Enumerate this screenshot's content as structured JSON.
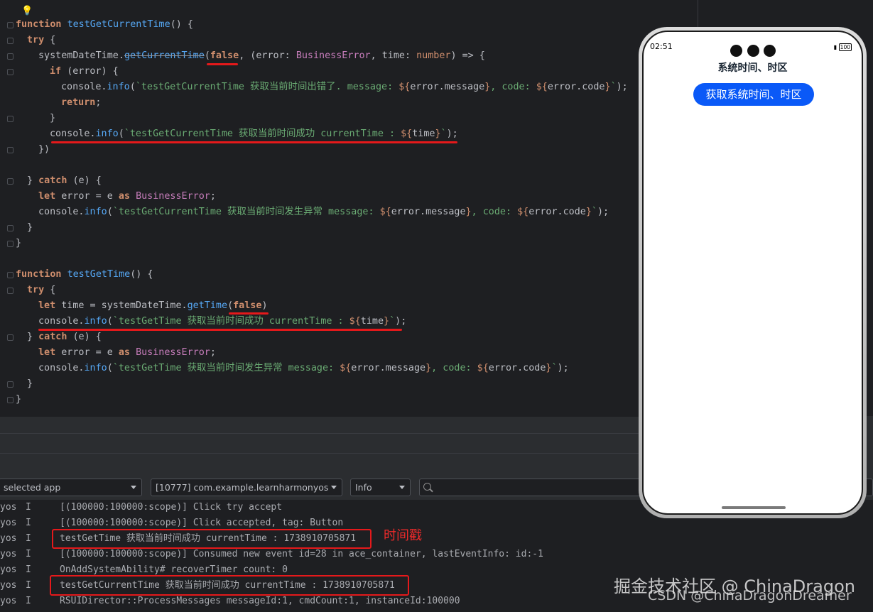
{
  "editor": {
    "lines": [
      {
        "indent": 0,
        "tokens": [
          [
            "kw",
            "function "
          ],
          [
            "fn",
            "testGetCurrentTime"
          ],
          [
            "nm",
            "() {"
          ]
        ]
      },
      {
        "indent": 1,
        "tokens": [
          [
            "kw",
            "try "
          ],
          [
            "nm",
            "{"
          ]
        ]
      },
      {
        "indent": 2,
        "tokens": [
          [
            "nm",
            "systemDateTime."
          ],
          [
            "fn-strike",
            "getCurrentTime"
          ],
          [
            "nm",
            "("
          ],
          [
            "bool",
            "false"
          ],
          [
            "nm",
            ", (error: "
          ],
          [
            "ty",
            "BusinessError"
          ],
          [
            "nm",
            ", time: "
          ],
          [
            "tyo",
            "number"
          ],
          [
            "nm",
            ") => {"
          ]
        ]
      },
      {
        "indent": 3,
        "tokens": [
          [
            "kw",
            "if "
          ],
          [
            "nm",
            "(error) {"
          ]
        ]
      },
      {
        "indent": 4,
        "tokens": [
          [
            "nm",
            "console."
          ],
          [
            "fn",
            "info"
          ],
          [
            "nm",
            "("
          ],
          [
            "str",
            "`testGetCurrentTime 获取当前时间出错了. message: "
          ],
          [
            "tpl",
            "${"
          ],
          [
            "nm",
            "error.message"
          ],
          [
            "tpl",
            "}"
          ],
          [
            "str",
            ", code: "
          ],
          [
            "tpl",
            "${"
          ],
          [
            "nm",
            "error.code"
          ],
          [
            "tpl",
            "}"
          ],
          [
            "str",
            "`"
          ],
          [
            "nm",
            ");"
          ]
        ]
      },
      {
        "indent": 4,
        "tokens": [
          [
            "kw",
            "return"
          ],
          [
            "nm",
            ";"
          ]
        ]
      },
      {
        "indent": 3,
        "tokens": [
          [
            "nm",
            "}"
          ]
        ]
      },
      {
        "indent": 3,
        "tokens": [
          [
            "nm",
            "console."
          ],
          [
            "fn",
            "info"
          ],
          [
            "nm",
            "("
          ],
          [
            "str",
            "`testGetCurrentTime 获取当前时间成功 currentTime : "
          ],
          [
            "tpl",
            "${"
          ],
          [
            "nm",
            "time"
          ],
          [
            "tpl",
            "}"
          ],
          [
            "str",
            "`"
          ],
          [
            "nm",
            ");"
          ]
        ]
      },
      {
        "indent": 2,
        "tokens": [
          [
            "nm",
            "})"
          ]
        ]
      },
      {
        "indent": 0,
        "tokens": []
      },
      {
        "indent": 1,
        "tokens": [
          [
            "nm",
            "} "
          ],
          [
            "kw",
            "catch "
          ],
          [
            "nm",
            "(e) {"
          ]
        ]
      },
      {
        "indent": 2,
        "tokens": [
          [
            "kw",
            "let "
          ],
          [
            "nm",
            "error = e "
          ],
          [
            "kw",
            "as "
          ],
          [
            "ty",
            "BusinessError"
          ],
          [
            "nm",
            ";"
          ]
        ]
      },
      {
        "indent": 2,
        "tokens": [
          [
            "nm",
            "console."
          ],
          [
            "fn",
            "info"
          ],
          [
            "nm",
            "("
          ],
          [
            "str",
            "`testGetCurrentTime 获取当前时间发生异常 message: "
          ],
          [
            "tpl",
            "${"
          ],
          [
            "nm",
            "error.message"
          ],
          [
            "tpl",
            "}"
          ],
          [
            "str",
            ", code: "
          ],
          [
            "tpl",
            "${"
          ],
          [
            "nm",
            "error.code"
          ],
          [
            "tpl",
            "}"
          ],
          [
            "str",
            "`"
          ],
          [
            "nm",
            ");"
          ]
        ]
      },
      {
        "indent": 1,
        "tokens": [
          [
            "nm",
            "}"
          ]
        ]
      },
      {
        "indent": 0,
        "tokens": [
          [
            "nm",
            "}"
          ]
        ]
      },
      {
        "indent": 0,
        "tokens": []
      },
      {
        "indent": 0,
        "tokens": [
          [
            "kw",
            "function "
          ],
          [
            "fn",
            "testGetTime"
          ],
          [
            "nm",
            "() {"
          ]
        ]
      },
      {
        "indent": 1,
        "tokens": [
          [
            "kw",
            "try "
          ],
          [
            "nm",
            "{"
          ]
        ]
      },
      {
        "indent": 2,
        "tokens": [
          [
            "kw",
            "let "
          ],
          [
            "nm",
            "time = systemDateTime."
          ],
          [
            "fn",
            "getTime"
          ],
          [
            "nm",
            "("
          ],
          [
            "bool",
            "false"
          ],
          [
            "nm",
            ")"
          ]
        ]
      },
      {
        "indent": 2,
        "tokens": [
          [
            "nm",
            "console."
          ],
          [
            "fn",
            "info"
          ],
          [
            "nm",
            "("
          ],
          [
            "str",
            "`testGetTime 获取当前时间成功 currentTime : "
          ],
          [
            "tpl",
            "${"
          ],
          [
            "nm",
            "time"
          ],
          [
            "tpl",
            "}"
          ],
          [
            "str",
            "`"
          ],
          [
            "nm",
            ");"
          ]
        ]
      },
      {
        "indent": 1,
        "tokens": [
          [
            "nm",
            "} "
          ],
          [
            "kw",
            "catch "
          ],
          [
            "nm",
            "(e) {"
          ]
        ]
      },
      {
        "indent": 2,
        "tokens": [
          [
            "kw",
            "let "
          ],
          [
            "nm",
            "error = e "
          ],
          [
            "kw",
            "as "
          ],
          [
            "ty",
            "BusinessError"
          ],
          [
            "nm",
            ";"
          ]
        ]
      },
      {
        "indent": 2,
        "tokens": [
          [
            "nm",
            "console."
          ],
          [
            "fn",
            "info"
          ],
          [
            "nm",
            "("
          ],
          [
            "str",
            "`testGetTime 获取当前时间发生异常 message: "
          ],
          [
            "tpl",
            "${"
          ],
          [
            "nm",
            "error.message"
          ],
          [
            "tpl",
            "}"
          ],
          [
            "str",
            ", code: "
          ],
          [
            "tpl",
            "${"
          ],
          [
            "nm",
            "error.code"
          ],
          [
            "tpl",
            "}"
          ],
          [
            "str",
            "`"
          ],
          [
            "nm",
            ");"
          ]
        ]
      },
      {
        "indent": 1,
        "tokens": [
          [
            "nm",
            "}"
          ]
        ]
      },
      {
        "indent": 0,
        "tokens": [
          [
            "nm",
            "}"
          ]
        ]
      }
    ]
  },
  "log_toolbar": {
    "device_select": "selected app",
    "process_select": "[10777] com.example.learnharmonyos",
    "level_select": "Info",
    "search_placeholder": ""
  },
  "log": {
    "lines": [
      {
        "prefix": "yos",
        "level": "I",
        "msg": "[(100000:100000:scope)] Click try accept"
      },
      {
        "prefix": "yos",
        "level": "I",
        "msg": "[(100000:100000:scope)] Click accepted, tag: Button"
      },
      {
        "prefix": "yos",
        "level": "I",
        "msg": "testGetTime 获取当前时间成功 currentTime : 1738910705871"
      },
      {
        "prefix": "yos",
        "level": "I",
        "msg": "[(100000:100000:scope)] Consumed new event id=28 in ace_container, lastEventInfo: id:-1"
      },
      {
        "prefix": "yos",
        "level": "I",
        "msg": "OnAddSystemAbility# recoverTimer count: 0"
      },
      {
        "prefix": "yos",
        "level": "I",
        "msg": "testGetCurrentTime 获取当前时间成功 currentTime : 1738910705871"
      },
      {
        "prefix": "yos",
        "level": "I",
        "msg": "RSUIDirector::ProcessMessages messageId:1, cmdCount:1, instanceId:100000"
      }
    ],
    "annotation": "时间戳"
  },
  "phone": {
    "status_time": "02:51",
    "battery": "100",
    "title": "系统时间、时区",
    "button_label": "获取系统时间、时区"
  },
  "watermark": {
    "line1": "掘金技术社区 @ ChinaDragon",
    "line2": "CSDN @ChinaDragonDreamer"
  },
  "colors": {
    "annotation_red": "#e5191b",
    "button_blue": "#0a59f7"
  }
}
